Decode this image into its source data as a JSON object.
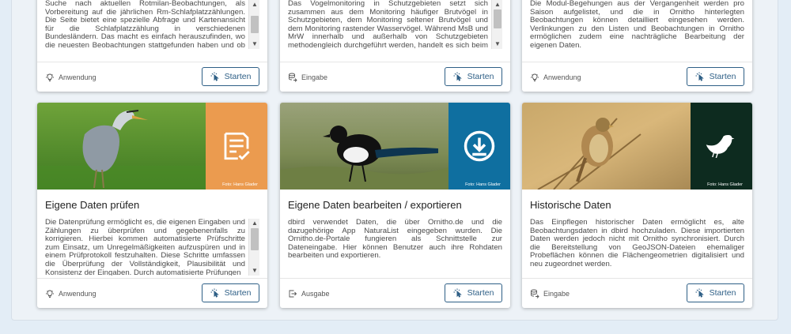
{
  "colors": {
    "orange": "#eb9b4f",
    "blue": "#0f6fa0",
    "dark_green": "#0d2b1f",
    "button_border": "#2e5f86"
  },
  "cards_top": [
    {
      "text": "Suche nach aktuellen Rotmilan-Beobachtungen, als Vorbereitung auf die jährlichen Rm-Schlafplatzzählungen. Die Seite bietet eine spezielle Abfrage und Kartenansicht für die Schlafplatzzählung in verschiedenen Bundesländern. Das macht es einfach herauszufinden, wo die neuesten Beobachtungen stattgefunden haben und ob sie in der Nähe bereits bekannter Schlafgebiete lagen.",
      "tag": "Anwendung",
      "tag_icon": "lightbulb-icon",
      "button": "Starten"
    },
    {
      "text": "Das Vogelmonitoring in Schutzgebieten setzt sich zusammen aus dem Monitoring häufiger Brutvögel in Schutzgebieten, dem Monitoring seltener Brutvögel und dem Monitoring rastender Wasservögel. Während MsB und MrW innerhalb und außerhalb von Schutzgebieten methodengleich durchgeführt werden, handelt es sich beim MhB-S um eine leicht abgewandelte Variante des",
      "tag": "Eingabe",
      "tag_icon": "data-input-icon",
      "button": "Starten"
    },
    {
      "text": "Die Modul-Begehungen aus der Vergangenheit werden pro Saison aufgelistet, und die in Ornitho hinterlegten Beobachtungen können detailliert eingesehen werden. Verlinkungen zu den Listen und Beobachtungen in Ornitho ermöglichen zudem eine nachträgliche Bearbeitung der eigenen Daten.",
      "tag": "Anwendung",
      "tag_icon": "lightbulb-icon",
      "button": "Starten"
    }
  ],
  "cards_bottom": [
    {
      "title": "Eigene Daten prüfen",
      "text": "Die Datenprüfung ermöglicht es, die eigenen Eingaben und Zählungen zu überprüfen und gegebenenfalls zu korrigieren. Hierbei kommen automatisierte Prüfschritte zum Einsatz, um Unregelmäßigkeiten aufzuspüren und in einem Prüfprotokoll festzuhalten. Diese Schritte umfassen die Überprüfung der Vollständigkeit, Plausibilität und Konsistenz der Eingaben. Durch automatisierte Prüfungen",
      "credit": "Foto: Hans Glader",
      "tag": "Anwendung",
      "tag_icon": "lightbulb-icon",
      "block_icon": "checklist-icon",
      "button": "Starten"
    },
    {
      "title": "Eigene Daten bearbeiten / exportieren",
      "text": "dbird verwendet Daten, die über Ornitho.de und die dazugehörige App NaturaList eingegeben wurden. Die Ornitho.de-Portale fungieren als Schnittstelle zur Dateneingabe. Hier können Benutzer auch ihre Rohdaten bearbeiten und exportieren.",
      "credit": "Foto: Hans Glader",
      "tag": "Ausgabe",
      "tag_icon": "data-output-icon",
      "block_icon": "download-icon",
      "button": "Starten"
    },
    {
      "title": "Historische Daten",
      "text": "Das Einpflegen historischer Daten ermöglicht es, alte Beobachtungsdaten in dbird hochzuladen. Diese importierten Daten werden jedoch nicht mit Ornitho synchronisiert. Durch die Bereitstellung von GeoJSON-Dateien ehemaliger Probeflächen können die Flächengeometrien digitalisiert und neu zugeordnet werden.",
      "credit": "Foto: Hans Glader",
      "tag": "Eingabe",
      "tag_icon": "data-input-icon",
      "block_icon": "bird-silhouette-icon",
      "button": "Starten"
    }
  ]
}
